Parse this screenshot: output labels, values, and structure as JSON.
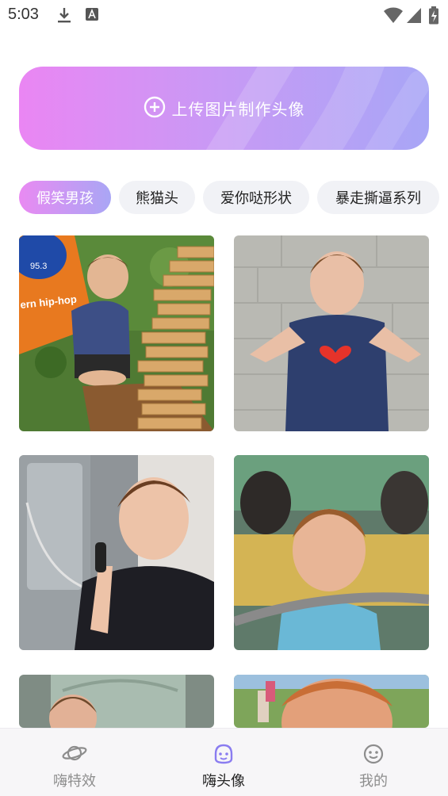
{
  "status_bar": {
    "time": "5:03",
    "icons": [
      "download-icon",
      "font-icon",
      "wifi-icon",
      "signal-icon",
      "battery-charging-icon"
    ]
  },
  "upload": {
    "label": "上传图片制作头像",
    "icon": "plus-circle-icon"
  },
  "tabs": [
    {
      "label": "假笑男孩",
      "active": true
    },
    {
      "label": "熊猫头",
      "active": false
    },
    {
      "label": "爱你哒形状",
      "active": false
    },
    {
      "label": "暴走撕逼系列",
      "active": false
    }
  ],
  "photos": {
    "overlay_texts": [
      "95.3",
      "ern hip-hop"
    ],
    "count": 6
  },
  "bottom_nav": {
    "items": [
      {
        "label": "嗨特效",
        "icon": "planet-icon",
        "active": false
      },
      {
        "label": "嗨头像",
        "icon": "face-avatar-icon",
        "active": true
      },
      {
        "label": "我的",
        "icon": "smiley-icon",
        "active": false
      }
    ]
  },
  "colors": {
    "accent_start": "#ea86f3",
    "accent_end": "#a8a6f6",
    "nav_active_icon": "#8a7cf0",
    "nav_inactive": "#8d8d8d"
  }
}
